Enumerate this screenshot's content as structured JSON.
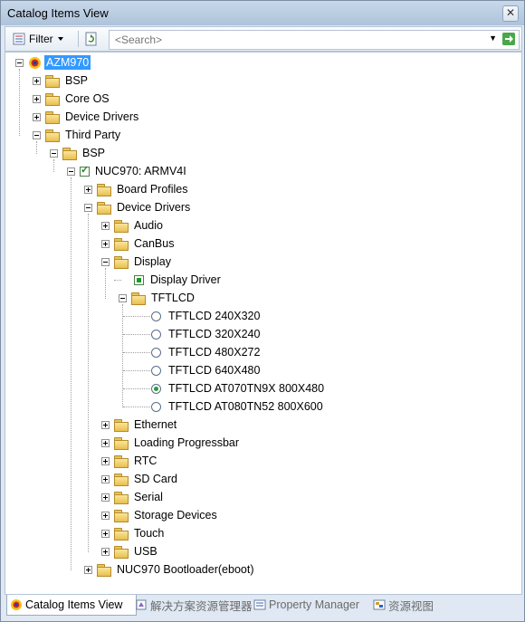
{
  "window": {
    "title": "Catalog Items View",
    "close_glyph": "✕"
  },
  "toolbar": {
    "filter_label": "Filter",
    "search_placeholder": "<Search>"
  },
  "tree": {
    "root": {
      "label": "AZM970",
      "selected": true
    },
    "items": [
      {
        "label": "BSP",
        "icon": "folder-icon",
        "expander": "plus"
      },
      {
        "label": "Core OS",
        "icon": "folder-icon",
        "expander": "plus"
      },
      {
        "label": "Device Drivers",
        "icon": "folder-icon",
        "expander": "plus"
      },
      {
        "label": "Third Party",
        "icon": "folder-icon",
        "expander": "minus"
      },
      {
        "label": "BSP",
        "icon": "folder-icon",
        "expander": "minus"
      },
      {
        "label": "NUC970: ARMV4I",
        "icon": "checkbox-checked-icon",
        "expander": "minus"
      },
      {
        "label": "Board Profiles",
        "icon": "folder-icon",
        "expander": "plus"
      },
      {
        "label": "Device Drivers",
        "icon": "folder-icon",
        "expander": "minus"
      },
      {
        "label": "Audio",
        "icon": "folder-icon",
        "expander": "plus"
      },
      {
        "label": "CanBus",
        "icon": "folder-icon",
        "expander": "plus"
      },
      {
        "label": "Display",
        "icon": "folder-icon",
        "expander": "minus"
      },
      {
        "label": "Display Driver",
        "icon": "component-included-icon",
        "expander": "none"
      },
      {
        "label": "TFTLCD",
        "icon": "folder-icon",
        "expander": "minus"
      },
      {
        "label": "TFTLCD 240X320",
        "icon": "radio-icon",
        "checked": false
      },
      {
        "label": "TFTLCD 320X240",
        "icon": "radio-icon",
        "checked": false
      },
      {
        "label": "TFTLCD 480X272",
        "icon": "radio-icon",
        "checked": false
      },
      {
        "label": "TFTLCD 640X480",
        "icon": "radio-icon",
        "checked": false
      },
      {
        "label": "TFTLCD AT070TN9X 800X480",
        "icon": "radio-icon",
        "checked": true
      },
      {
        "label": "TFTLCD AT080TN52 800X600",
        "icon": "radio-icon",
        "checked": false
      },
      {
        "label": "Ethernet",
        "icon": "folder-icon",
        "expander": "plus"
      },
      {
        "label": "Loading Progressbar",
        "icon": "folder-icon",
        "expander": "plus"
      },
      {
        "label": "RTC",
        "icon": "folder-icon",
        "expander": "plus"
      },
      {
        "label": "SD Card",
        "icon": "folder-icon",
        "expander": "plus"
      },
      {
        "label": "Serial",
        "icon": "folder-icon",
        "expander": "plus"
      },
      {
        "label": "Storage Devices",
        "icon": "folder-icon",
        "expander": "plus"
      },
      {
        "label": "Touch",
        "icon": "folder-icon",
        "expander": "plus"
      },
      {
        "label": "USB",
        "icon": "folder-icon",
        "expander": "plus"
      },
      {
        "label": "NUC970 Bootloader(eboot)",
        "icon": "folder-icon",
        "expander": "plus"
      }
    ]
  },
  "bottom_tabs": [
    {
      "label": "Catalog Items View",
      "active": true
    },
    {
      "label": "解决方案资源管理器",
      "active": false
    },
    {
      "label": "Property Manager",
      "active": false
    },
    {
      "label": "资源视图",
      "active": false
    }
  ],
  "colors": {
    "selection": "#3399ff",
    "included": "#1a9a2a",
    "folder": "#e8bf4e"
  }
}
